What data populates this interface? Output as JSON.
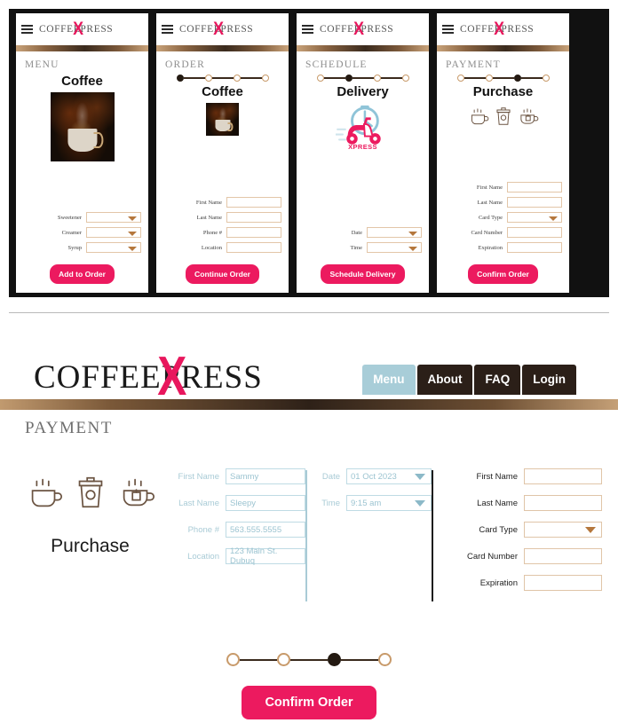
{
  "brand": {
    "name_left": "COFFEE",
    "x": "X",
    "name_right": "PRESS"
  },
  "colors": {
    "accent_pink": "#ec1a5f",
    "logo_x_pink": "#e8175d",
    "nav_active": "#a8cdd8",
    "nav_dark": "#2b1f18",
    "field_border_tan": "#e0c5a8",
    "field_border_blue": "#bfdbe4",
    "dot_active": "#241a12",
    "dot_inactive_border": "#c89a6a"
  },
  "mobile_screens": [
    {
      "section": "MENU",
      "title": "Coffee",
      "has_steps": false,
      "steps": [],
      "media": "coffee-photo-large",
      "fields": [
        {
          "label": "Sweetener",
          "type": "select",
          "value": ""
        },
        {
          "label": "Creamer",
          "type": "select",
          "value": ""
        },
        {
          "label": "Syrup",
          "type": "select",
          "value": ""
        }
      ],
      "button": "Add to Order"
    },
    {
      "section": "ORDER",
      "title": "Coffee",
      "has_steps": true,
      "steps": [
        true,
        false,
        false,
        false
      ],
      "media": "coffee-photo-small",
      "fields": [
        {
          "label": "First Name",
          "type": "text",
          "value": ""
        },
        {
          "label": "Last Name",
          "type": "text",
          "value": ""
        },
        {
          "label": "Phone #",
          "type": "text",
          "value": ""
        },
        {
          "label": "Location",
          "type": "text",
          "value": ""
        }
      ],
      "button": "Continue Order"
    },
    {
      "section": "SCHEDULE",
      "title": "Delivery",
      "has_steps": true,
      "steps": [
        false,
        true,
        false,
        false
      ],
      "media": "scooter-xpress-icon",
      "media_caption": "XPRESS",
      "fields": [
        {
          "label": "Date",
          "type": "select",
          "value": ""
        },
        {
          "label": "Time",
          "type": "select",
          "value": ""
        }
      ],
      "button": "Schedule Delivery"
    },
    {
      "section": "PAYMENT",
      "title": "Purchase",
      "has_steps": true,
      "steps": [
        false,
        false,
        true,
        false
      ],
      "media": "three-cups-icon",
      "fields": [
        {
          "label": "First Name",
          "type": "text",
          "value": ""
        },
        {
          "label": "Last Name",
          "type": "text",
          "value": ""
        },
        {
          "label": "Card Type",
          "type": "select",
          "value": ""
        },
        {
          "label": "Card Number",
          "type": "text",
          "value": ""
        },
        {
          "label": "Expiration",
          "type": "text",
          "value": ""
        }
      ],
      "button": "Confirm Order"
    }
  ],
  "desktop": {
    "nav": [
      {
        "label": "Menu",
        "active": true
      },
      {
        "label": "About",
        "active": false
      },
      {
        "label": "FAQ",
        "active": false
      },
      {
        "label": "Login",
        "active": false
      }
    ],
    "page_title": "PAYMENT",
    "purchase_label": "Purchase",
    "order_info": [
      {
        "label": "First Name",
        "value": "Sammy"
      },
      {
        "label": "Last Name",
        "value": "Sleepy"
      },
      {
        "label": "Phone #",
        "value": "563.555.5555"
      },
      {
        "label": "Location",
        "value": "123 Main St. Dubuq"
      }
    ],
    "schedule_info": [
      {
        "label": "Date",
        "value": "01 Oct 2023"
      },
      {
        "label": "Time",
        "value": "9:15 am"
      }
    ],
    "payment_fields": [
      {
        "label": "First Name",
        "value": "",
        "type": "text"
      },
      {
        "label": "Last Name",
        "value": "",
        "type": "text"
      },
      {
        "label": "Card Type",
        "value": "",
        "type": "select"
      },
      {
        "label": "Card Number",
        "value": "",
        "type": "text"
      },
      {
        "label": "Expiration",
        "value": "",
        "type": "text"
      }
    ],
    "steps": [
      false,
      false,
      true,
      false
    ],
    "button": "Confirm Order"
  }
}
